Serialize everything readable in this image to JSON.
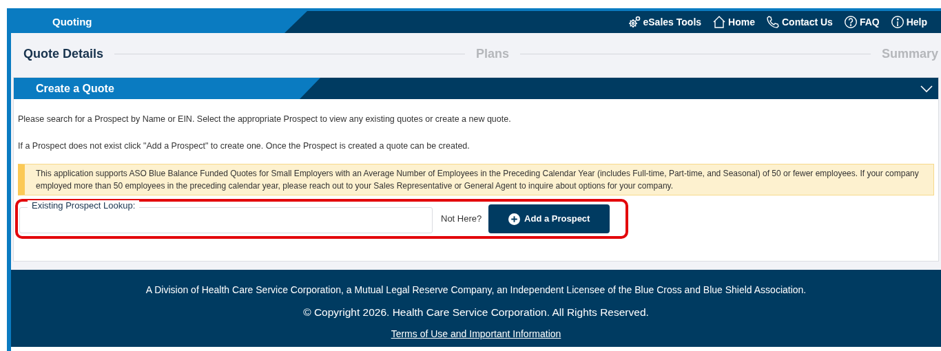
{
  "header": {
    "app_title": "Quoting",
    "nav": [
      {
        "kind": "gears",
        "label": "eSales Tools"
      },
      {
        "kind": "home",
        "label": "Home"
      },
      {
        "kind": "phone",
        "label": "Contact Us"
      },
      {
        "kind": "faq",
        "label": "FAQ"
      },
      {
        "kind": "info",
        "label": "Help"
      }
    ]
  },
  "steps": [
    {
      "label": "Quote Details",
      "selected": true
    },
    {
      "label": "Plans",
      "selected": false
    },
    {
      "label": "Summary",
      "selected": false
    }
  ],
  "panel": {
    "title": "Create a Quote",
    "expanded": true,
    "paragraphs": [
      "Please search for a Prospect by Name or EIN. Select the appropriate Prospect to view any existing quotes or create a new quote.",
      "If a Prospect does not exist click \"Add a Prospect\" to create one. Once the Prospect is created a quote can be created."
    ],
    "notice": "This application supports ASO Blue Balance Funded Quotes for Small Employers with an Average Number of Employees in the Preceding Calendar Year (includes Full-time, Part-time, and Seasonal) of 50 or fewer employees. If your company employed more than 50 employees in the preceding calendar year, please reach out to your Sales Representative or General Agent to inquire about options for your company.",
    "lookup_label": "Existing Prospect Lookup:",
    "not_here": "Not Here?",
    "add_button": "Add a Prospect"
  },
  "footer": {
    "lines": [
      "A Division of Health Care Service Corporation, a Mutual Legal Reserve Company, an Independent Licensee of the Blue Cross and Blue Shield Association.",
      "© Copyright 2026. Health Care Service Corporation. All Rights Reserved."
    ],
    "link": "Terms of Use and Important Information"
  }
}
